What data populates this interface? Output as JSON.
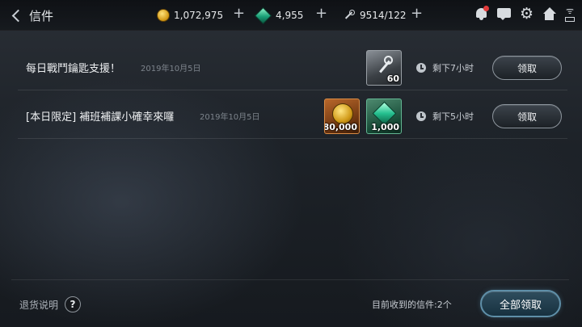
{
  "header": {
    "title": "信件",
    "currencies": [
      {
        "icon": "gold-coin-icon",
        "value": "1,072,975"
      },
      {
        "icon": "green-gem-icon",
        "value": "4,955"
      },
      {
        "icon": "key-icon",
        "value": "9514/122"
      }
    ],
    "icons": [
      "bell-icon",
      "chat-icon",
      "gear-icon",
      "home-icon",
      "wifi-battery-icon"
    ]
  },
  "mails": [
    {
      "subject": "每日戰鬥鑰匙支援！",
      "date": "2019年10月5日",
      "rewards": [
        {
          "icon": "key-icon",
          "qty": "60",
          "rarity": "gray"
        }
      ],
      "remaining": "剩下7小时",
      "claim_label": "领取"
    },
    {
      "subject": "[本日限定] 補班補課小確幸來囉",
      "date": "2019年10月5日",
      "rewards": [
        {
          "icon": "gold-coin-icon",
          "qty": "80,000",
          "rarity": "orange"
        },
        {
          "icon": "green-gem-icon",
          "qty": "1,000",
          "rarity": "green"
        }
      ],
      "remaining": "剩下5小时",
      "claim_label": "领取"
    }
  ],
  "footer": {
    "refund_label": "退货说明",
    "help_glyph": "?",
    "count_text": "目前收到的信件:2个",
    "claim_all_label": "全部领取"
  }
}
